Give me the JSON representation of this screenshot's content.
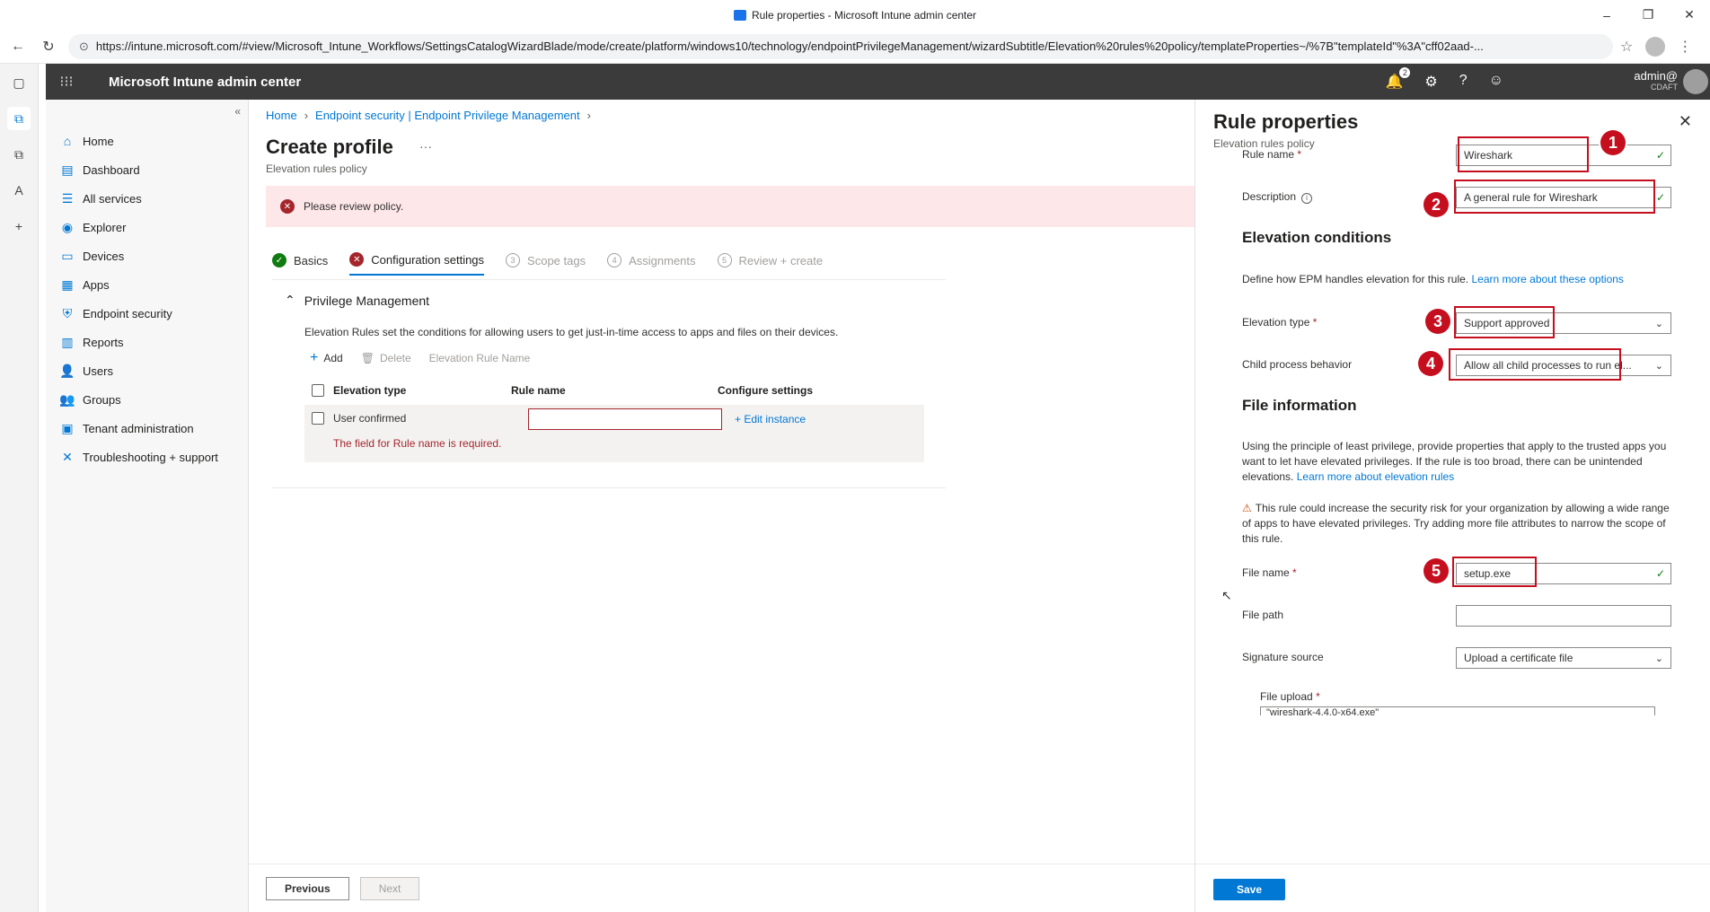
{
  "browser": {
    "title": "Rule properties - Microsoft Intune admin center",
    "url": "https://intune.microsoft.com/#view/Microsoft_Intune_Workflows/SettingsCatalogWizardBlade/mode/create/platform/windows10/technology/endpointPrivilegeManagement/wizardSubtitle/Elevation%20rules%20policy/templateProperties~/%7B\"templateId\"%3A\"cff02aad-...",
    "minimize": "–",
    "maximize": "❐",
    "close": "✕",
    "back": "←",
    "reload": "↻",
    "lock": "⊙",
    "star": "☆",
    "kebab": "⋮"
  },
  "strip": {
    "tabs": "▢",
    "intune": "⧉",
    "intune2": "⧉",
    "azure": "A",
    "add": "+"
  },
  "header": {
    "waffle": "⁝⁝⁝",
    "title": "Microsoft Intune admin center",
    "notif_count": "2",
    "bell": "🔔",
    "gear": "⚙",
    "help": "?",
    "feedback": "☺",
    "user": "admin@",
    "tenant": "CDAFT"
  },
  "sidenav": {
    "collapse": "«",
    "items": [
      {
        "label": "Home",
        "icon": "⌂"
      },
      {
        "label": "Dashboard",
        "icon": "▤"
      },
      {
        "label": "All services",
        "icon": "☰"
      },
      {
        "label": "Explorer",
        "icon": "◉"
      },
      {
        "label": "Devices",
        "icon": "▭"
      },
      {
        "label": "Apps",
        "icon": "▦"
      },
      {
        "label": "Endpoint security",
        "icon": "⛨"
      },
      {
        "label": "Reports",
        "icon": "▥"
      },
      {
        "label": "Users",
        "icon": "👤"
      },
      {
        "label": "Groups",
        "icon": "👥"
      },
      {
        "label": "Tenant administration",
        "icon": "▣"
      },
      {
        "label": "Troubleshooting + support",
        "icon": "✕"
      }
    ]
  },
  "main": {
    "breadcrumb": [
      "Home",
      "Endpoint security | Endpoint Privilege Management"
    ],
    "title": "Create profile",
    "more": "···",
    "subtitle": "Elevation rules policy",
    "alert": "Please review policy.",
    "steps": [
      {
        "label": "Basics",
        "mark": "✓"
      },
      {
        "label": "Configuration settings",
        "mark": "✕"
      },
      {
        "label": "Scope tags",
        "mark": "3"
      },
      {
        "label": "Assignments",
        "mark": "4"
      },
      {
        "label": "Review + create",
        "mark": "5"
      }
    ],
    "section": "Privilege Management",
    "section_desc": "Elevation Rules set the conditions for allowing users to get just-in-time access to apps and files on their devices.",
    "toolbar": {
      "add": "Add",
      "delete": "Delete",
      "name_col": "Elevation Rule Name"
    },
    "grid": {
      "headers": [
        "Elevation type",
        "Rule name",
        "Configure settings"
      ],
      "row": {
        "type": "User confirmed",
        "edit": "+ Edit instance",
        "error": "The field for Rule name is required."
      }
    },
    "footer": {
      "previous": "Previous",
      "next": "Next"
    }
  },
  "panel": {
    "title": "Rule properties",
    "subtitle": "Elevation rules policy",
    "close": "✕",
    "rule_name_label": "Rule name",
    "rule_name_value": "Wireshark",
    "description_label": "Description",
    "description_value": "A general rule for Wireshark",
    "elevation_heading": "Elevation conditions",
    "elevation_desc": "Define how EPM handles elevation for this rule.",
    "elevation_link": "Learn more about these options",
    "elevation_type_label": "Elevation type",
    "elevation_type_value": "Support approved",
    "child_label": "Child process behavior",
    "child_value": "Allow all child processes to run el...",
    "file_heading": "File information",
    "file_desc": "Using the principle of least privilege, provide properties that apply to the trusted apps you want to let have elevated privileges. If the rule is too broad, there can be unintended elevations.",
    "file_link": "Learn more about elevation rules",
    "warning": "This rule could increase the security risk for your organization by allowing a wide range of apps to have elevated privileges. Try adding more file attributes to narrow the scope of this rule.",
    "file_name_label": "File name",
    "file_name_value": "setup.exe",
    "file_path_label": "File path",
    "file_path_value": "",
    "signature_label": "Signature source",
    "signature_value": "Upload a certificate file",
    "upload_label": "File upload",
    "upload_value": "\"wireshark-4.4.0-x64.exe\"",
    "save": "Save",
    "markers": [
      "1",
      "2",
      "3",
      "4",
      "5"
    ]
  }
}
